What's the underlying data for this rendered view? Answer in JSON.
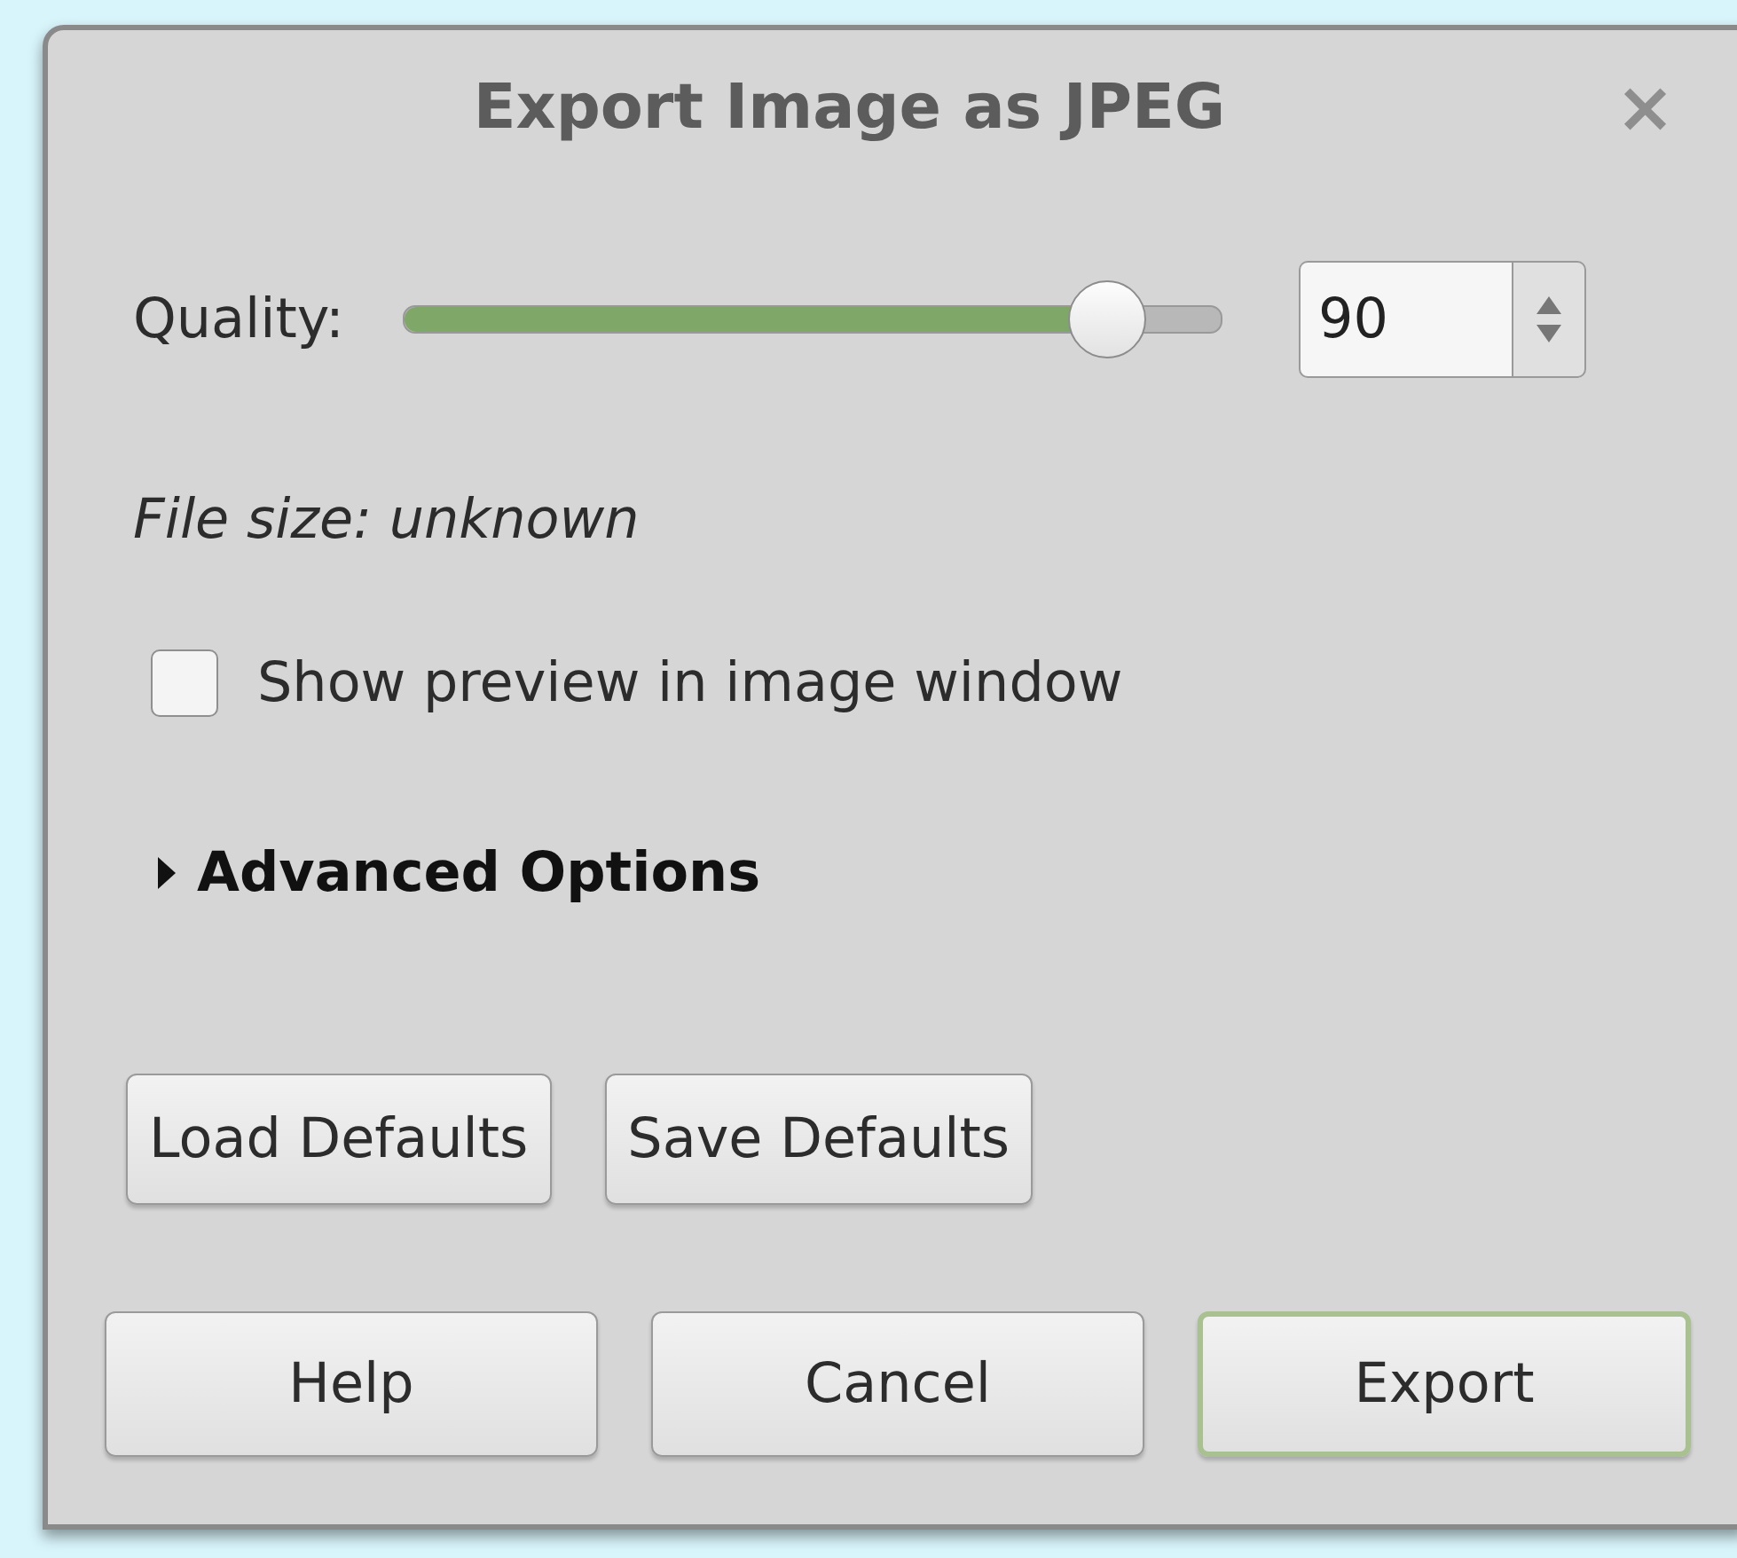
{
  "window": {
    "title": "Export Image as JPEG",
    "close_glyph": "×"
  },
  "quality": {
    "label": "Quality:",
    "level": 0.86,
    "value": "90"
  },
  "file_size": "File size: unknown",
  "preview_checkbox": {
    "label": "Show preview in image window",
    "checked": false
  },
  "advanced": {
    "label": "Advanced Options",
    "expanded": false
  },
  "defaults_buttons": [
    "Load Defaults",
    "Save Defaults"
  ],
  "buttons": [
    {
      "label": "Help",
      "default": false
    },
    {
      "label": "Cancel",
      "default": false
    },
    {
      "label": "Export",
      "default": true
    }
  ]
}
